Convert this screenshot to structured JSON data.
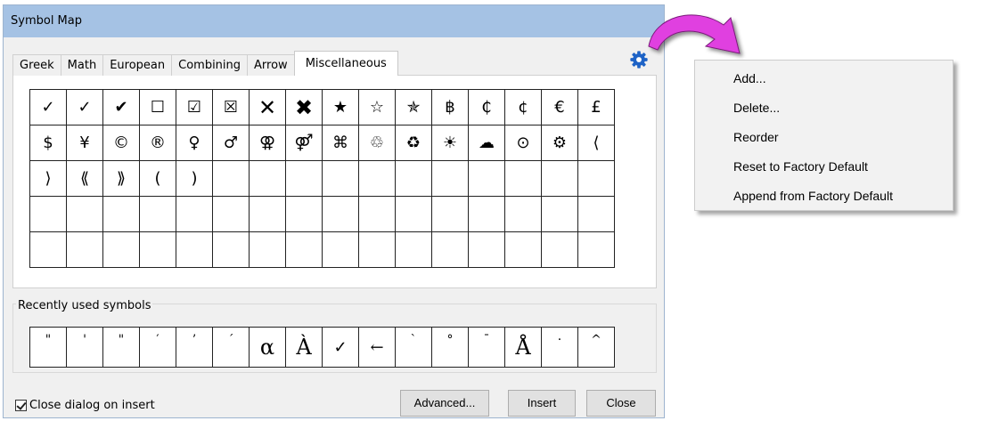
{
  "dialog": {
    "title": "Symbol Map",
    "tabs": [
      "Greek",
      "Math",
      "European",
      "Combining",
      "Arrow",
      "Miscellaneous"
    ],
    "active_tab": "Miscellaneous",
    "settings_icon": "gear-icon",
    "symbols": [
      [
        "✓",
        "✓",
        "✔",
        "☐",
        "☑",
        "☒",
        "✕",
        "✖",
        "★",
        "☆",
        "✯",
        "฿",
        "₵",
        "¢",
        "€",
        "£"
      ],
      [
        "$",
        "¥",
        "©",
        "®",
        "♀",
        "♂",
        "⚢",
        "⚤",
        "⌘",
        "♲",
        "♻",
        "☀",
        "☁",
        "⊙",
        "⚙",
        "⟨"
      ],
      [
        "⟩",
        "⟪",
        "⟫",
        "(",
        ")",
        "",
        "",
        "",
        "",
        "",
        "",
        "",
        "",
        "",
        "",
        ""
      ],
      [
        "",
        "",
        "",
        "",
        "",
        "",
        "",
        "",
        "",
        "",
        "",
        "",
        "",
        "",
        "",
        ""
      ],
      [
        "",
        "",
        "",
        "",
        "",
        "",
        "",
        "",
        "",
        "",
        "",
        "",
        "",
        "",
        "",
        ""
      ]
    ],
    "recent_label": "Recently used symbols",
    "recent": [
      "\"",
      "'",
      "\"",
      "′",
      "’",
      "´",
      "α",
      "À",
      "✓",
      "←",
      "`",
      "°",
      "¯",
      "Å",
      "·",
      "^"
    ],
    "close_on_insert_label": "Close dialog on insert",
    "close_on_insert_checked": true,
    "buttons": {
      "advanced": "Advanced...",
      "insert": "Insert",
      "close": "Close"
    }
  },
  "callout": {
    "arrow_color": "#e040e0"
  },
  "context_menu": {
    "items": [
      "Add...",
      "Delete...",
      "Reorder",
      "Reset to Factory Default",
      "Append from Factory Default"
    ]
  }
}
